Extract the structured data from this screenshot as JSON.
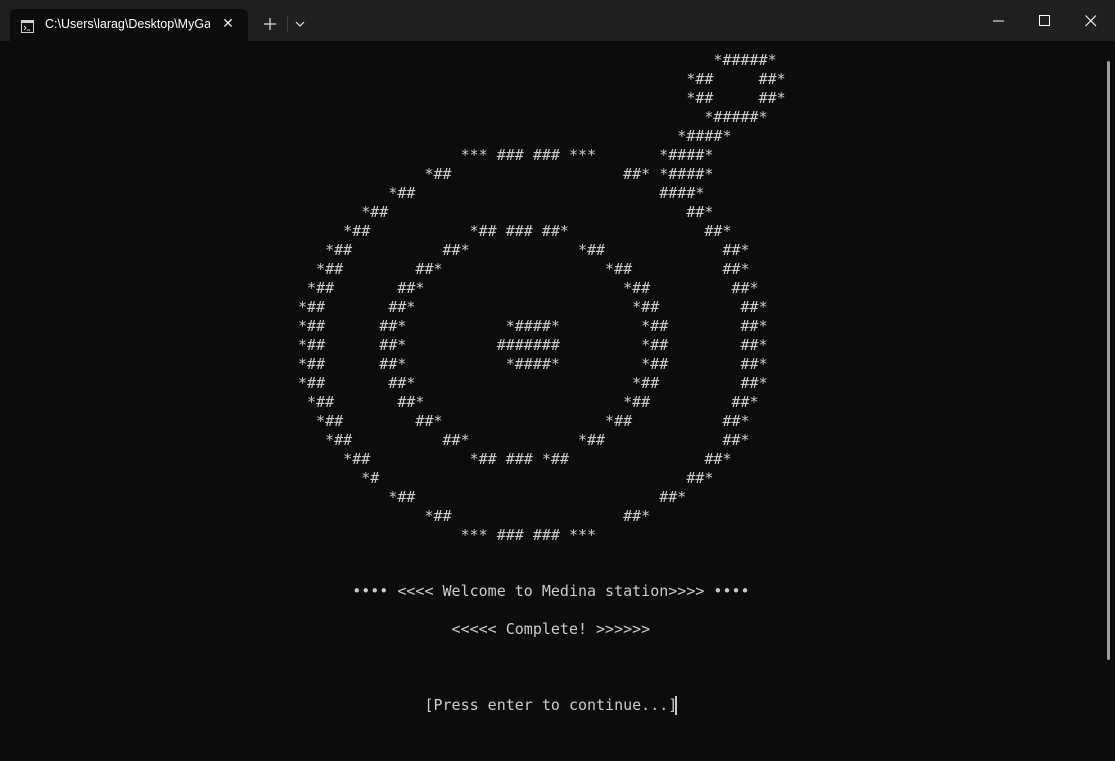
{
  "window": {
    "tab_title": "C:\\Users\\larag\\Desktop\\MyGame\\MyGame.exe",
    "tab_icon": "terminal-icon",
    "close_tab_glyph": "✕",
    "new_tab_icon": "plus-icon",
    "dropdown_icon": "chevron-down-icon",
    "minimize_icon": "minimize-icon",
    "maximize_icon": "maximize-icon",
    "close_icon": "close-icon"
  },
  "console": {
    "ascii_art": "                                                                               *#####*\n                                                                            *##     ##*\n                                                                            *##     ##*\n                                                                              *#####*\n                                                                           *####*\n                                                   *** ### ### ***       *####*\n                                               *##                   ##* *####*\n                                           *##                           ####*\n                                        *##                                 ##*\n                                      *##           *## ### ##*               ##*\n                                    *##          ##*            *##             ##*\n                                   *##        ##*                  *##          ##*\n                                  *##       ##*                      *##         ##*\n                                 *##       ##*                        *##         ##*\n                                 *##      ##*           *####*         *##        ##*\n                                 *##      ##*          #######         *##        ##*\n                                 *##      ##*           *####*         *##        ##*\n                                 *##       ##*                        *##         ##*\n                                  *##       ##*                      *##         ##*\n                                   *##        ##*                  *##          ##*\n                                    *##          ##*            *##             ##*\n                                      *##           *## ### *##               ##*\n                                        *#                                  ##*\n                                           *##                           ##*\n                                               *##                   ##*\n                                                   *** ### ### ***",
    "welcome_line": "                                       •••• <<<< Welcome to Medina station>>>> ••••",
    "complete_line": "                                                  <<<<< Complete! >>>>>>",
    "prompt_line": "                                               [Press enter to continue...]"
  },
  "colors": {
    "background": "#0c0c0c",
    "text": "#cccccc",
    "titlebar": "#1f1f1f"
  }
}
